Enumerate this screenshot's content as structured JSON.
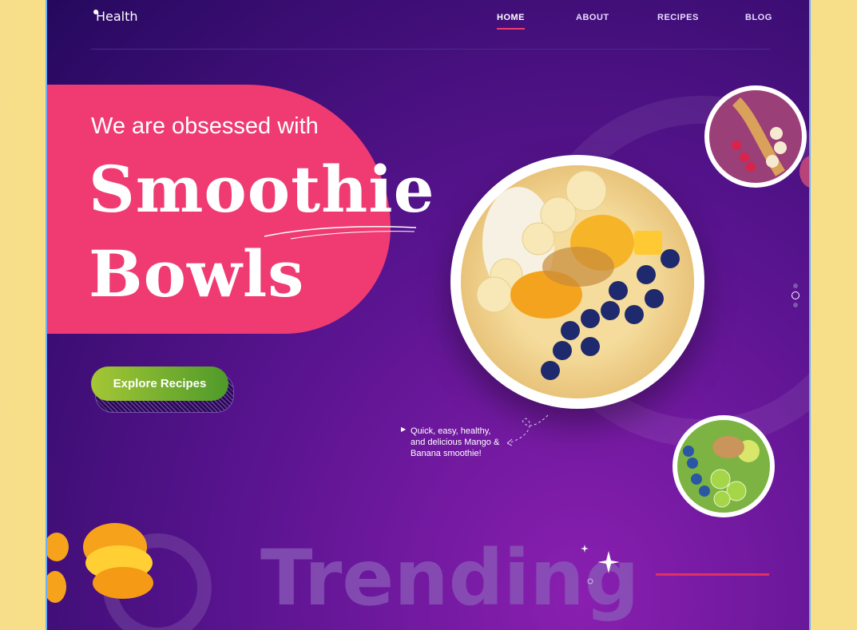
{
  "brand": {
    "name": "Health"
  },
  "nav": {
    "items": [
      "HOME",
      "ABOUT",
      "RECIPES",
      "BLOG"
    ],
    "active": "HOME"
  },
  "hero": {
    "subtitle": "We are obsessed with",
    "title_line1": "Smoothie",
    "title_line2": "Bowls",
    "cta_label": "Explore Recipes",
    "caption": "Quick, easy, healthy, and delicious Mango & Banana smoothie!"
  },
  "section": {
    "heading": "Trending"
  },
  "slider": {
    "total": 3,
    "current": 2
  },
  "colors": {
    "accent_pink": "#ef3b72",
    "cta_green": "#7bb42e",
    "bg_purple": "#4a1285",
    "underline_red": "#e2315e"
  }
}
